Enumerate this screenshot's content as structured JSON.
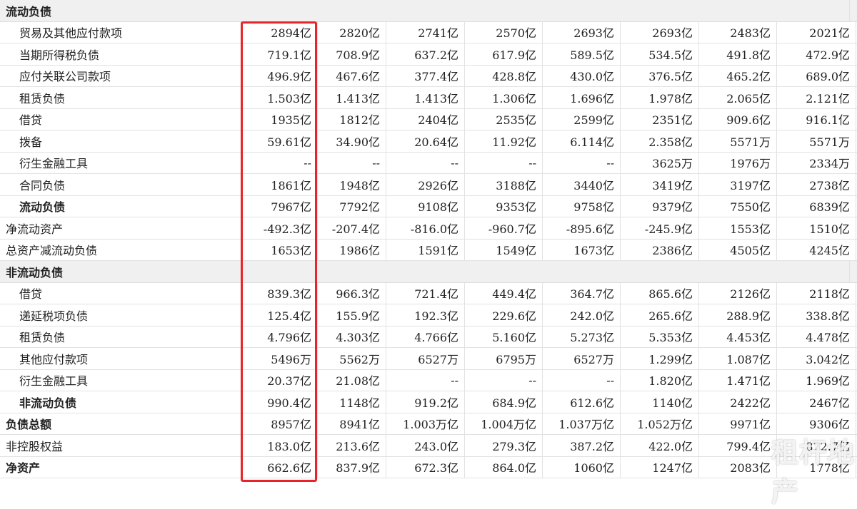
{
  "section_current": "流动负债",
  "section_noncurrent": "非流动负债",
  "rows_current": [
    {
      "label": "贸易及其他应付款项",
      "values": [
        "2894亿",
        "2820亿",
        "2741亿",
        "2570亿",
        "2693亿",
        "2693亿",
        "2483亿",
        "2021亿"
      ]
    },
    {
      "label": "当期所得税负债",
      "values": [
        "719.1亿",
        "708.9亿",
        "637.2亿",
        "617.9亿",
        "589.5亿",
        "534.5亿",
        "491.8亿",
        "472.9亿"
      ]
    },
    {
      "label": "应付关联公司款项",
      "values": [
        "496.9亿",
        "467.6亿",
        "377.4亿",
        "428.8亿",
        "430.0亿",
        "376.5亿",
        "465.2亿",
        "689.0亿"
      ]
    },
    {
      "label": "租赁负债",
      "values": [
        "1.503亿",
        "1.413亿",
        "1.413亿",
        "1.306亿",
        "1.696亿",
        "1.978亿",
        "2.065亿",
        "2.121亿"
      ]
    },
    {
      "label": "借贷",
      "values": [
        "1935亿",
        "1812亿",
        "2404亿",
        "2535亿",
        "2599亿",
        "2351亿",
        "909.6亿",
        "916.1亿"
      ]
    },
    {
      "label": "拨备",
      "values": [
        "59.61亿",
        "34.90亿",
        "20.64亿",
        "11.92亿",
        "6.114亿",
        "2.358亿",
        "5571万",
        "5571万"
      ]
    },
    {
      "label": "衍生金融工具",
      "values": [
        "--",
        "--",
        "--",
        "--",
        "--",
        "3625万",
        "1976万",
        "2334万"
      ]
    },
    {
      "label": "合同负债",
      "values": [
        "1861亿",
        "1948亿",
        "2926亿",
        "3188亿",
        "3440亿",
        "3419亿",
        "3197亿",
        "2738亿"
      ]
    },
    {
      "label": "流动负债",
      "values": [
        "7967亿",
        "7792亿",
        "9108亿",
        "9353亿",
        "9758亿",
        "9379亿",
        "7550亿",
        "6839亿"
      ]
    },
    {
      "label": "净流动资产",
      "values": [
        "-492.3亿",
        "-207.4亿",
        "-816.0亿",
        "-960.7亿",
        "-895.6亿",
        "-245.9亿",
        "1553亿",
        "1510亿"
      ]
    },
    {
      "label": "总资产减流动负债",
      "values": [
        "1653亿",
        "1986亿",
        "1591亿",
        "1549亿",
        "1673亿",
        "2386亿",
        "4505亿",
        "4245亿"
      ]
    }
  ],
  "rows_noncurrent": [
    {
      "label": "借贷",
      "values": [
        "839.3亿",
        "966.3亿",
        "721.4亿",
        "449.4亿",
        "364.7亿",
        "865.6亿",
        "2126亿",
        "2118亿"
      ]
    },
    {
      "label": "递延税项负债",
      "values": [
        "125.4亿",
        "155.9亿",
        "192.3亿",
        "229.6亿",
        "242.0亿",
        "265.6亿",
        "288.9亿",
        "338.8亿"
      ]
    },
    {
      "label": "租赁负债",
      "values": [
        "4.796亿",
        "4.303亿",
        "4.766亿",
        "5.160亿",
        "5.273亿",
        "5.353亿",
        "4.453亿",
        "4.478亿"
      ]
    },
    {
      "label": "其他应付款项",
      "values": [
        "5496万",
        "5562万",
        "6527万",
        "6795万",
        "6527万",
        "1.299亿",
        "1.087亿",
        "3.042亿"
      ]
    },
    {
      "label": "衍生金融工具",
      "values": [
        "20.37亿",
        "21.08亿",
        "--",
        "--",
        "--",
        "1.820亿",
        "1.471亿",
        "1.969亿"
      ]
    },
    {
      "label": "非流动负债",
      "values": [
        "990.4亿",
        "1148亿",
        "919.2亿",
        "684.9亿",
        "612.6亿",
        "1140亿",
        "2422亿",
        "2467亿"
      ]
    },
    {
      "label": "负债总额",
      "values": [
        "8957亿",
        "8941亿",
        "1.003万亿",
        "1.004万亿",
        "1.037万亿",
        "1.052万亿",
        "9971亿",
        "9306亿"
      ]
    },
    {
      "label": "非控股权益",
      "values": [
        "183.0亿",
        "213.6亿",
        "243.0亿",
        "279.3亿",
        "387.2亿",
        "422.0亿",
        "799.4亿",
        "872.7亿"
      ]
    },
    {
      "label": "净资产",
      "values": [
        "662.6亿",
        "837.9亿",
        "672.3亿",
        "864.0亿",
        "1060亿",
        "1247亿",
        "2083亿",
        "1778亿"
      ]
    }
  ],
  "watermark": "租杆地产",
  "colors": {
    "highlight_border": "#e8242a",
    "section_bg": "#f0f0f0"
  }
}
